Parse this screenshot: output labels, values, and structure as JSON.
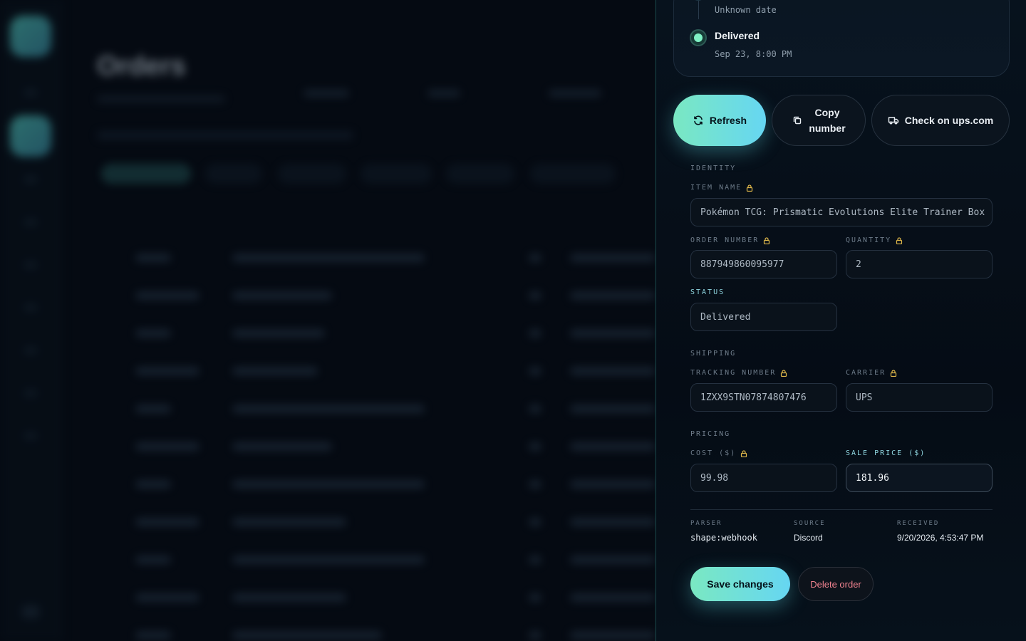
{
  "background": {
    "page_title": "Orders"
  },
  "timeline": {
    "previous_date": "Unknown date",
    "current_status": "Delivered",
    "current_date": "Sep 23, 8:00 PM"
  },
  "actions": {
    "refresh_label": "Refresh",
    "copy_line1": "Copy",
    "copy_line2": "number",
    "check_label": "Check on ups.com"
  },
  "identity": {
    "section": "IDENTITY",
    "item_name_label": "ITEM NAME",
    "item_name": "Pokémon TCG: Prismatic Evolutions Elite Trainer Box",
    "order_number_label": "ORDER NUMBER",
    "order_number": "887949860095977",
    "quantity_label": "QUANTITY",
    "quantity": "2",
    "status_label": "STATUS",
    "status": "Delivered"
  },
  "shipping": {
    "section": "SHIPPING",
    "tracking_label": "TRACKING NUMBER",
    "tracking": "1ZXX9STN07874807476",
    "carrier_label": "CARRIER",
    "carrier": "UPS"
  },
  "pricing": {
    "section": "PRICING",
    "cost_label": "COST ($)",
    "cost": "99.98",
    "sale_label": "SALE PRICE ($)",
    "sale": "181.96"
  },
  "meta": {
    "parser_label": "PARSER",
    "parser": "shape:webhook",
    "source_label": "SOURCE",
    "source": "Discord",
    "received_label": "RECEIVED",
    "received": "9/20/2026, 4:53:47 PM"
  },
  "footer": {
    "save_label": "Save changes",
    "delete_label": "Delete order"
  },
  "colors": {
    "accent_start": "#7ae8c2",
    "accent_end": "#66d6f2",
    "lock": "#e0b84a",
    "danger": "#f0828f"
  }
}
